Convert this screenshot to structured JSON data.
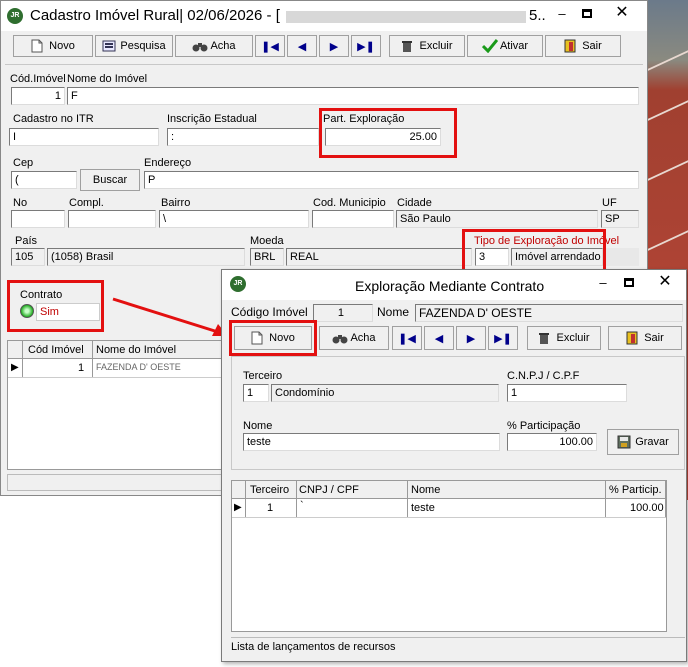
{
  "main_window": {
    "title": "Cadastro Imóvel Rural|  02/06/2026 - [",
    "title_tail": "5..",
    "logo": "JR",
    "toolbar": {
      "novo": "Novo",
      "pesquisa": "Pesquisa",
      "acha": "Acha",
      "excluir": "Excluir",
      "ativar": "Ativar",
      "sair": "Sair"
    },
    "labels": {
      "cod_imovel": "Cód.Imóvel",
      "nome_imovel": "Nome do Imóvel",
      "cadastro_itr": "Cadastro no ITR",
      "inscricao_estadual": "Inscrição Estadual",
      "part_exploracao": "Part. Exploração",
      "cep": "Cep",
      "endereco": "Endereço",
      "no": "No",
      "compl": "Compl.",
      "bairro": "Bairro",
      "cod_municipio": "Cod. Municipio",
      "cidade": "Cidade",
      "uf": "UF",
      "pais": "País",
      "moeda": "Moeda",
      "tipo_exploracao": "Tipo de Exploração do Imóvel",
      "contrato": "Contrato"
    },
    "values": {
      "cod_imovel": "1",
      "nome_imovel": "F",
      "cadastro_itr": "I",
      "inscricao_estadual": ":",
      "part_exploracao": "25.00",
      "cep": "(",
      "endereco": "P",
      "bairro": "\\",
      "cidade": "São Paulo",
      "uf": "SP",
      "pais_code": "105",
      "pais_name": "(1058) Brasil",
      "moeda_code": "BRL",
      "moeda_name": "REAL",
      "tipo_code": "3",
      "tipo_name": "Imóvel arrendado",
      "contrato": "Sim"
    },
    "buscar": "Buscar",
    "grid": {
      "headers": [
        "Cód Imóvel",
        "Nome do Imóvel"
      ],
      "rows": [
        {
          "cod": "1",
          "nome": "FAZENDA D' OESTE"
        }
      ]
    }
  },
  "dialog": {
    "title": "Exploração Mediante Contrato",
    "logo": "JR",
    "codigo_label": "Código Imóvel",
    "codigo_value": "1",
    "nome_label": "Nome",
    "nome_value": "FAZENDA D' OESTE",
    "toolbar": {
      "novo": "Novo",
      "acha": "Acha",
      "excluir": "Excluir",
      "sair": "Sair"
    },
    "terceiro_label": "Terceiro",
    "terceiro_code": "1",
    "terceiro_name": "Condomínio",
    "cnpj_label": "C.N.P.J / C.P.F",
    "cnpj_value": "1",
    "nome_label2": "Nome",
    "nome_input": "teste",
    "part_label": "% Participação",
    "part_value": "100.00",
    "gravar": "Gravar",
    "grid": {
      "headers": [
        "Terceiro",
        "CNPJ / CPF",
        "Nome",
        "% Particip."
      ],
      "rows": [
        {
          "terceiro": "1",
          "cnpj": "`",
          "nome": "teste",
          "particip": "100.00"
        }
      ]
    },
    "status": "Lista de lançamentos de recursos"
  },
  "colors": {
    "highlight": "#e31010",
    "label_red": "#c00000",
    "window_bg": "#f0f0f0",
    "background_track": "#b83a2f"
  }
}
